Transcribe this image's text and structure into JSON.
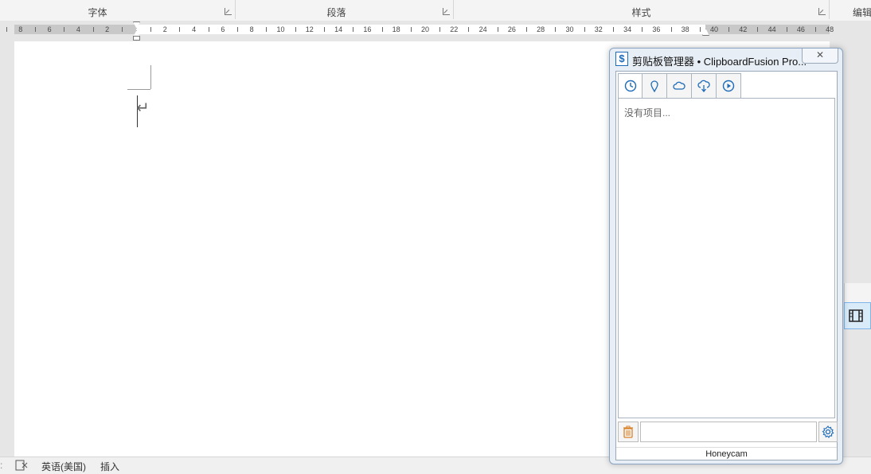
{
  "ribbon": {
    "groups": [
      {
        "label": "字体"
      },
      {
        "label": "段落"
      },
      {
        "label": "样式"
      },
      {
        "label": "编辑"
      }
    ]
  },
  "ruler": {
    "left_ticks": [
      "8",
      "6",
      "4",
      "2"
    ],
    "right_ticks": [
      "2",
      "4",
      "6",
      "8",
      "10",
      "12",
      "14",
      "16",
      "18",
      "20",
      "22",
      "24",
      "26",
      "28",
      "30",
      "32",
      "34",
      "36",
      "38",
      "40",
      "42",
      "44",
      "46",
      "48"
    ]
  },
  "document": {
    "paragraph_mark": "↵"
  },
  "status_bar": {
    "language": "英语(美国)",
    "mode": "插入"
  },
  "clipboard_window": {
    "app_icon": "$",
    "title": "剪贴板管理器 • ClipboardFusion Pro...",
    "close_label": "✕",
    "tabs": [
      {
        "icon": "clock-icon"
      },
      {
        "icon": "pin-icon"
      },
      {
        "icon": "cloud-icon"
      },
      {
        "icon": "cloud-sync-icon"
      },
      {
        "icon": "play-icon"
      }
    ],
    "empty_text": "没有项目...",
    "search": {
      "value": "",
      "placeholder": ""
    },
    "footer": "Honeycam"
  },
  "colors": {
    "accent": "#1e6bb8",
    "trash": "#d9822b",
    "window_border": "#8aa3c2"
  }
}
